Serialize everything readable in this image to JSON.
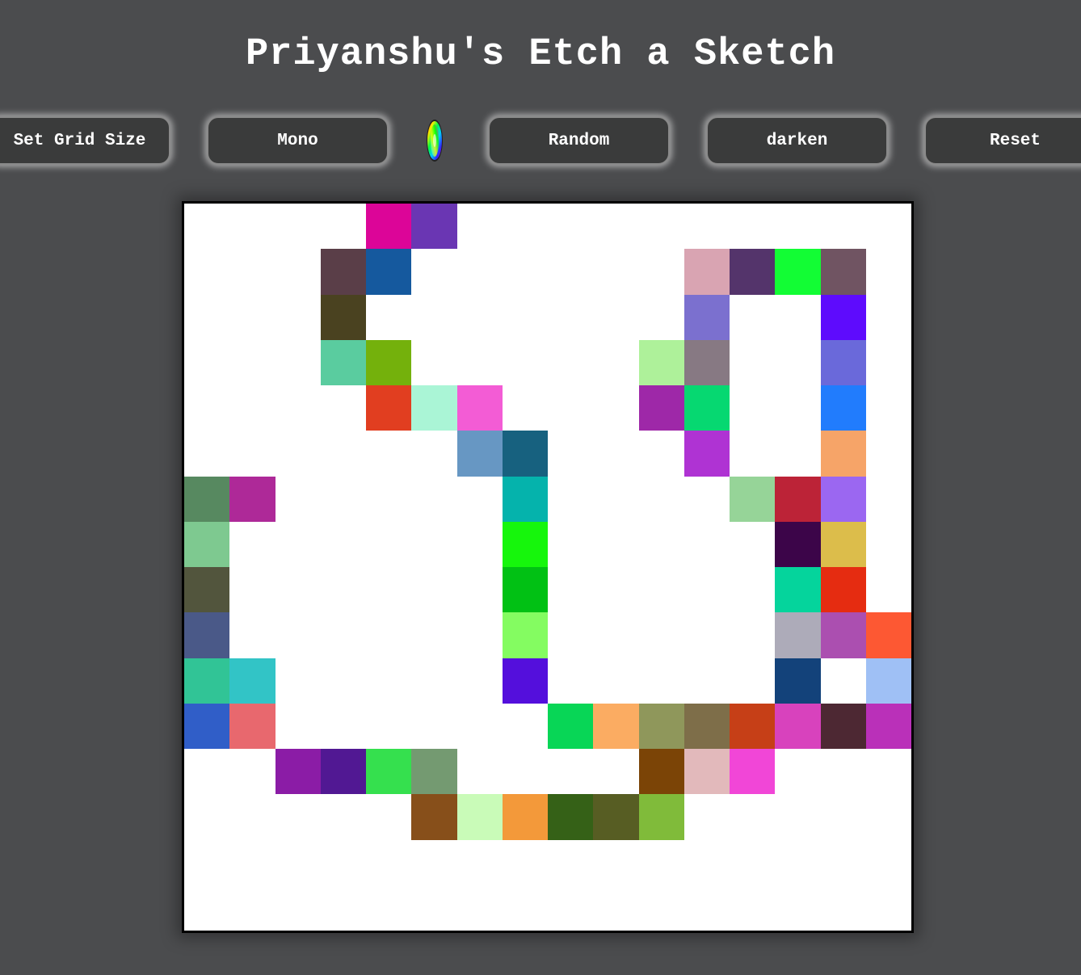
{
  "header": {
    "title": "Priyanshu's Etch a Sketch"
  },
  "toolbar": {
    "grid_size_label": "Set Grid Size",
    "mono_label": "Mono",
    "color_picker_icon": "rainbow-color-wheel-icon",
    "random_label": "Random",
    "darken_label": "darken",
    "reset_label": "Reset"
  },
  "board": {
    "grid_size": 16,
    "background_color": "#ffffff",
    "painted_cells": [
      {
        "row": 0,
        "col": 4,
        "color": "#dc0598"
      },
      {
        "row": 0,
        "col": 5,
        "color": "#6a36b3"
      },
      {
        "row": 1,
        "col": 3,
        "color": "#5a3e48"
      },
      {
        "row": 1,
        "col": 4,
        "color": "#15599e"
      },
      {
        "row": 1,
        "col": 11,
        "color": "#d9a4b2"
      },
      {
        "row": 1,
        "col": 12,
        "color": "#54346b"
      },
      {
        "row": 1,
        "col": 13,
        "color": "#12fd34"
      },
      {
        "row": 1,
        "col": 14,
        "color": "#705462"
      },
      {
        "row": 2,
        "col": 3,
        "color": "#4a4220"
      },
      {
        "row": 2,
        "col": 11,
        "color": "#7b70cf"
      },
      {
        "row": 2,
        "col": 14,
        "color": "#5e0bfd"
      },
      {
        "row": 3,
        "col": 3,
        "color": "#5acc9f"
      },
      {
        "row": 3,
        "col": 4,
        "color": "#74b10c"
      },
      {
        "row": 3,
        "col": 10,
        "color": "#aef19a"
      },
      {
        "row": 3,
        "col": 11,
        "color": "#877983"
      },
      {
        "row": 3,
        "col": 14,
        "color": "#6a69da"
      },
      {
        "row": 4,
        "col": 4,
        "color": "#e13e20"
      },
      {
        "row": 4,
        "col": 5,
        "color": "#aaf5d6"
      },
      {
        "row": 4,
        "col": 6,
        "color": "#f35cd5"
      },
      {
        "row": 4,
        "col": 10,
        "color": "#9e28a8"
      },
      {
        "row": 4,
        "col": 11,
        "color": "#06d871"
      },
      {
        "row": 4,
        "col": 14,
        "color": "#217cfd"
      },
      {
        "row": 5,
        "col": 6,
        "color": "#6797c3"
      },
      {
        "row": 5,
        "col": 7,
        "color": "#17617f"
      },
      {
        "row": 5,
        "col": 11,
        "color": "#af33d3"
      },
      {
        "row": 5,
        "col": 14,
        "color": "#f6a468"
      },
      {
        "row": 6,
        "col": 0,
        "color": "#578960"
      },
      {
        "row": 6,
        "col": 1,
        "color": "#ae2998"
      },
      {
        "row": 6,
        "col": 7,
        "color": "#05b3ac"
      },
      {
        "row": 6,
        "col": 12,
        "color": "#96d498"
      },
      {
        "row": 6,
        "col": 13,
        "color": "#bc2337"
      },
      {
        "row": 6,
        "col": 14,
        "color": "#9b67f1"
      },
      {
        "row": 7,
        "col": 0,
        "color": "#7ec990"
      },
      {
        "row": 7,
        "col": 7,
        "color": "#16f60c"
      },
      {
        "row": 7,
        "col": 13,
        "color": "#3c0549"
      },
      {
        "row": 7,
        "col": 14,
        "color": "#dcbd4b"
      },
      {
        "row": 8,
        "col": 0,
        "color": "#52553d"
      },
      {
        "row": 8,
        "col": 7,
        "color": "#01c114"
      },
      {
        "row": 8,
        "col": 13,
        "color": "#05d49c"
      },
      {
        "row": 8,
        "col": 14,
        "color": "#e52c11"
      },
      {
        "row": 9,
        "col": 0,
        "color": "#4a5988"
      },
      {
        "row": 9,
        "col": 7,
        "color": "#84fc61"
      },
      {
        "row": 9,
        "col": 13,
        "color": "#adabb9"
      },
      {
        "row": 9,
        "col": 14,
        "color": "#ab4fb0"
      },
      {
        "row": 9,
        "col": 15,
        "color": "#fd5833"
      },
      {
        "row": 10,
        "col": 0,
        "color": "#31c496"
      },
      {
        "row": 10,
        "col": 1,
        "color": "#32c4c6"
      },
      {
        "row": 10,
        "col": 7,
        "color": "#540fdc"
      },
      {
        "row": 10,
        "col": 13,
        "color": "#13427a"
      },
      {
        "row": 10,
        "col": 15,
        "color": "#9fc0f5"
      },
      {
        "row": 11,
        "col": 0,
        "color": "#305ec8"
      },
      {
        "row": 11,
        "col": 1,
        "color": "#e8686e"
      },
      {
        "row": 11,
        "col": 8,
        "color": "#08d656"
      },
      {
        "row": 11,
        "col": 9,
        "color": "#fbac62"
      },
      {
        "row": 11,
        "col": 10,
        "color": "#8f975b"
      },
      {
        "row": 11,
        "col": 11,
        "color": "#7e6e49"
      },
      {
        "row": 11,
        "col": 12,
        "color": "#c63f17"
      },
      {
        "row": 11,
        "col": 13,
        "color": "#d842bd"
      },
      {
        "row": 11,
        "col": 14,
        "color": "#4d2833"
      },
      {
        "row": 11,
        "col": 15,
        "color": "#ba30b9"
      },
      {
        "row": 12,
        "col": 2,
        "color": "#8b1ca6"
      },
      {
        "row": 12,
        "col": 3,
        "color": "#511893"
      },
      {
        "row": 12,
        "col": 4,
        "color": "#35e04e"
      },
      {
        "row": 12,
        "col": 5,
        "color": "#749a71"
      },
      {
        "row": 12,
        "col": 10,
        "color": "#7b4406"
      },
      {
        "row": 12,
        "col": 11,
        "color": "#e2b9bb"
      },
      {
        "row": 12,
        "col": 12,
        "color": "#f146d7"
      },
      {
        "row": 13,
        "col": 5,
        "color": "#874f1a"
      },
      {
        "row": 13,
        "col": 6,
        "color": "#c9fbb8"
      },
      {
        "row": 13,
        "col": 7,
        "color": "#f3993a"
      },
      {
        "row": 13,
        "col": 8,
        "color": "#356117"
      },
      {
        "row": 13,
        "col": 9,
        "color": "#575d23"
      },
      {
        "row": 13,
        "col": 10,
        "color": "#80bb3a"
      }
    ]
  }
}
